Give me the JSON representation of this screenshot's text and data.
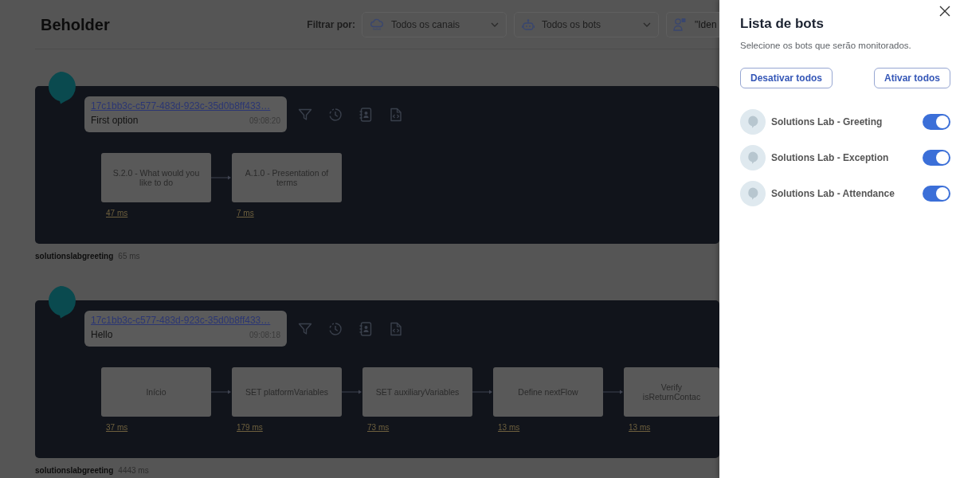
{
  "app": {
    "title": "Beholder"
  },
  "filters": {
    "label": "Filtrar por:",
    "fields": [
      {
        "kind": "channel",
        "value": "Todos os canais"
      },
      {
        "kind": "bot",
        "value": "Todos os bots"
      },
      {
        "kind": "user",
        "placeholder": "\"Iden"
      }
    ]
  },
  "sessions": [
    {
      "message": {
        "id": "17c1bb3c-c577-483d-923c-35d0b8ff433…",
        "text": "First option",
        "time": "09:08:20"
      },
      "steps": [
        {
          "label": "S.2.0 - What would you like to do",
          "duration": "47 ms"
        },
        {
          "label": "A.1.0 - Presentation of terms",
          "duration": "7 ms"
        }
      ],
      "bot": "solutionslabgreeting",
      "total": "65 ms"
    },
    {
      "message": {
        "id": "17c1bb3c-c577-483d-923c-35d0b8ff433…",
        "text": "Hello",
        "time": "09:08:18"
      },
      "steps": [
        {
          "label": "Início",
          "duration": "37 ms"
        },
        {
          "label": "SET platformVariables",
          "duration": "179 ms"
        },
        {
          "label": "SET auxiliaryVariables",
          "duration": "73 ms"
        },
        {
          "label": "Define nextFlow",
          "duration": "13 ms"
        },
        {
          "label": "Verify isReturnContac",
          "duration": "13 ms"
        }
      ],
      "bot": "solutionslabgreeting",
      "total": "4443 ms"
    }
  ],
  "drawer": {
    "title": "Lista de bots",
    "subtitle": "Selecione os bots que serão monitorados.",
    "buttons": [
      "Desativar todos",
      "Ativar todos"
    ],
    "bots": [
      {
        "name": "Solutions Lab - Greeting",
        "on": true
      },
      {
        "name": "Solutions Lab - Exception",
        "on": true
      },
      {
        "name": "Solutions Lab - Attendance",
        "on": true
      }
    ]
  }
}
